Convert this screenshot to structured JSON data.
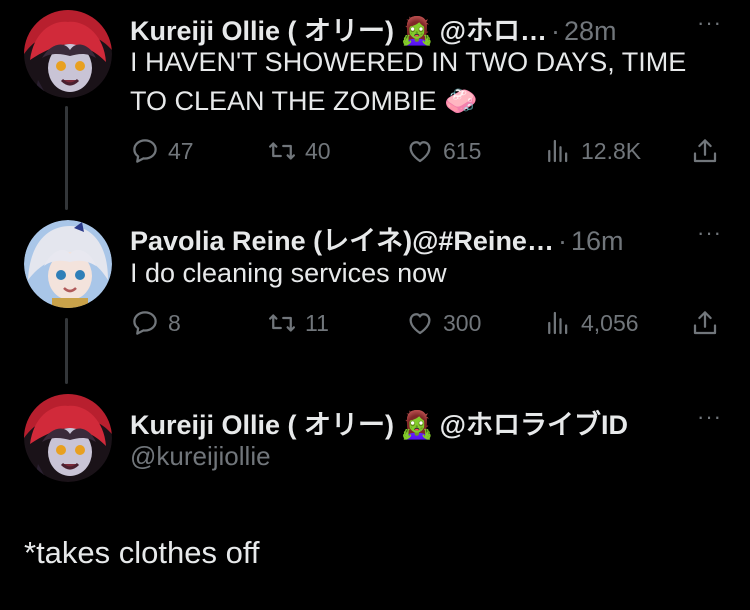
{
  "tweets": [
    {
      "name": "Kureiji Ollie ( オリー)",
      "name_emoji": "🧟‍♀️",
      "handle": "@ホロ…",
      "dot": "·",
      "time": "28m",
      "more": "···",
      "text_line1": "I HAVEN'T SHOWERED IN TWO DAYS, TIME",
      "text_line2": "TO CLEAN THE ZOMBIE",
      "text_emoji": "🧼",
      "replies": "47",
      "retweets": "40",
      "likes": "615",
      "views": "12.8K"
    },
    {
      "name": "Pavolia Reine (レイネ)",
      "handle": "@#Reine…",
      "dot": "·",
      "time": "16m",
      "more": "···",
      "text": "I do cleaning services now",
      "replies": "8",
      "retweets": "11",
      "likes": "300",
      "views": "4,056"
    }
  ],
  "focused": {
    "name": "Kureiji Ollie ( オリー)",
    "name_emoji": "🧟‍♀️",
    "affiliation": "@ホロライブID",
    "handle": "@kureijiollie",
    "more": "···",
    "text": "*takes clothes off"
  },
  "icons": [
    "reply-icon",
    "retweet-icon",
    "like-icon",
    "views-icon",
    "share-icon"
  ],
  "colors": {
    "background": "#000000",
    "primary_text": "#e7e9ea",
    "secondary_text": "#71767b",
    "thread_line": "#333639"
  }
}
